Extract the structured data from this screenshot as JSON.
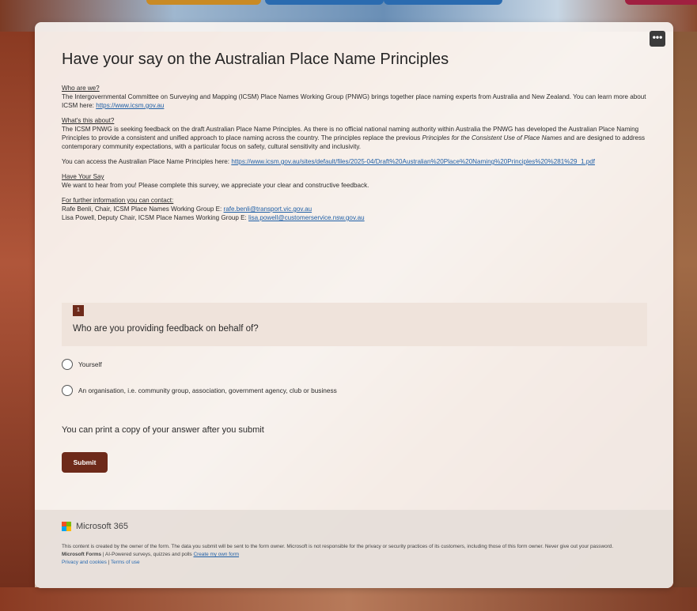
{
  "form": {
    "title": "Have your say on the Australian Place Name Principles",
    "more_icon": "•••",
    "sections": {
      "who_heading": "Who are we?",
      "who_text": "The Intergovernmental Committee on Surveying and Mapping (ICSM) Place Names Working Group (PNWG) brings together place naming experts from Australia and New Zealand. You can learn more about ICSM here: ",
      "who_link": "https://www.icsm.gov.au",
      "about_heading": "What's this about?",
      "about_text_1": "The ICSM PNWG is seeking feedback on the draft Australian Place Name Principles. As there is no official national naming authority within Australia the PNWG has developed the Australian Place Naming Principles to provide a consistent and unified approach to place naming across the country. The principles replace the previous ",
      "about_italic": "Principles for the Consistent Use of Place Names",
      "about_text_2": " and are designed to address contemporary community expectations, with a particular focus on safety, cultural sensitivity and inclusivity.",
      "access_text": "You can access the Australian Place Name Principles here: ",
      "access_link": "https://www.icsm.gov.au/sites/default/files/2025-04/Draft%20Australian%20Place%20Naming%20Principles%20%281%29_1.pdf",
      "say_heading": "Have Your Say",
      "say_text": "We want to hear from you! Please complete this survey, we appreciate your clear and constructive feedback.",
      "contact_heading": "For further information you can contact:",
      "contact_1_text": "Rafe Benli, Chair, ICSM Place Names Working Group  E: ",
      "contact_1_email": "rafe.benli@transport.vic.gov.au",
      "contact_2_text": "Lisa Powell, Deputy Chair, ICSM Place Names Working Group  E: ",
      "contact_2_email": "lisa.powell@customerservice.nsw.gov.au"
    },
    "question": {
      "number": "1",
      "text": "Who are you providing feedback on behalf of?",
      "options": [
        "Yourself",
        "An organisation, i.e. community group, association, government agency, club or business"
      ]
    },
    "print_note": "You can print a copy of your answer after you submit",
    "submit_label": "Submit"
  },
  "footer": {
    "brand": "Microsoft 365",
    "disclaimer": "This content is created by the owner of the form. The data you submit will be sent to the form owner. Microsoft is not responsible for the privacy or security practices of its customers, including those of this form owner. Never give out your password.",
    "forms_bold": "Microsoft Forms",
    "forms_text": " | AI-Powered surveys, quizzes and polls ",
    "create_link": "Create my own form",
    "privacy_link": "Privacy and cookies",
    "separator": " | ",
    "terms_link": "Terms of use"
  }
}
